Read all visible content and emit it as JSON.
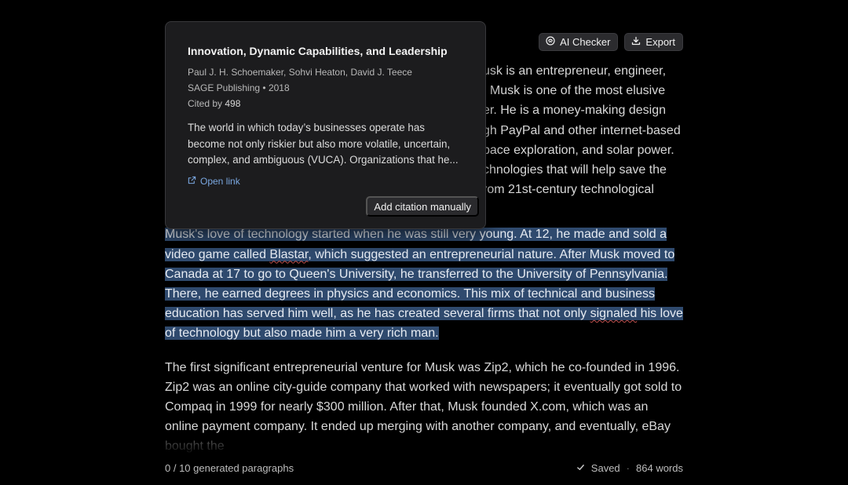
{
  "toolbar": {
    "ai_checker_label": "AI Checker",
    "export_label": "Export"
  },
  "editor": {
    "paragraph_1_lines": [
      "usk is an entrepreneur, engineer,",
      ", Musk is one of the most elusive",
      "er. He is a money-making design",
      "gh PayPal and other internet-based",
      "pace exploration, and solar power.",
      "chnologies that will help save the",
      "rom 21st-century technological"
    ],
    "paragraph_2_a": "Musk's love of technology started when he was still very young. At 12, he made and sold a video game called ",
    "paragraph_2_spell_1": "Blastar",
    "paragraph_2_b": ", which suggested an entrepreneurial nature. After Musk moved to Canada at 17 to go to Queen's University, he transferred to the University of Pennsylvania. There, he earned degrees in physics and economics. This mix of technical and business education has served him well, as he has created several firms that not only ",
    "paragraph_2_spell_2": "signaled",
    "paragraph_2_c": " his love of technology but also made him a very rich man.",
    "paragraph_3": "The first significant entrepreneurial venture for Musk was Zip2, which he co-founded in 1996. Zip2 was an online city-guide company that worked with newspapers; it eventually got sold to Compaq in 1999 for nearly $300 million. After that, Musk founded X.com, which was an online payment company. It ended up merging with another company, and eventually, eBay bought the"
  },
  "popover": {
    "title": "Innovation, Dynamic Capabilities, and Leadership",
    "authors": "Paul J. H. Schoemaker, Sohvi Heaton, David J. Teece",
    "publisher": "SAGE Publishing",
    "year": "2018",
    "cited_by_label": "Cited by",
    "cited_by_count": "498",
    "abstract": "The world in which today’s businesses operate has become not only riskier but also more volatile, uncertain, complex, and ambiguous (VUCA). Organizations that he...",
    "open_link_label": "Open link",
    "add_citation_label": "Add citation manually"
  },
  "footer": {
    "generated": "0 / 10 generated paragraphs",
    "saved_label": "Saved",
    "separator": "·",
    "word_count": "864 words"
  },
  "colors": {
    "background": "#000000",
    "selection": "#2f4a6e",
    "link": "#7aa7e0"
  }
}
